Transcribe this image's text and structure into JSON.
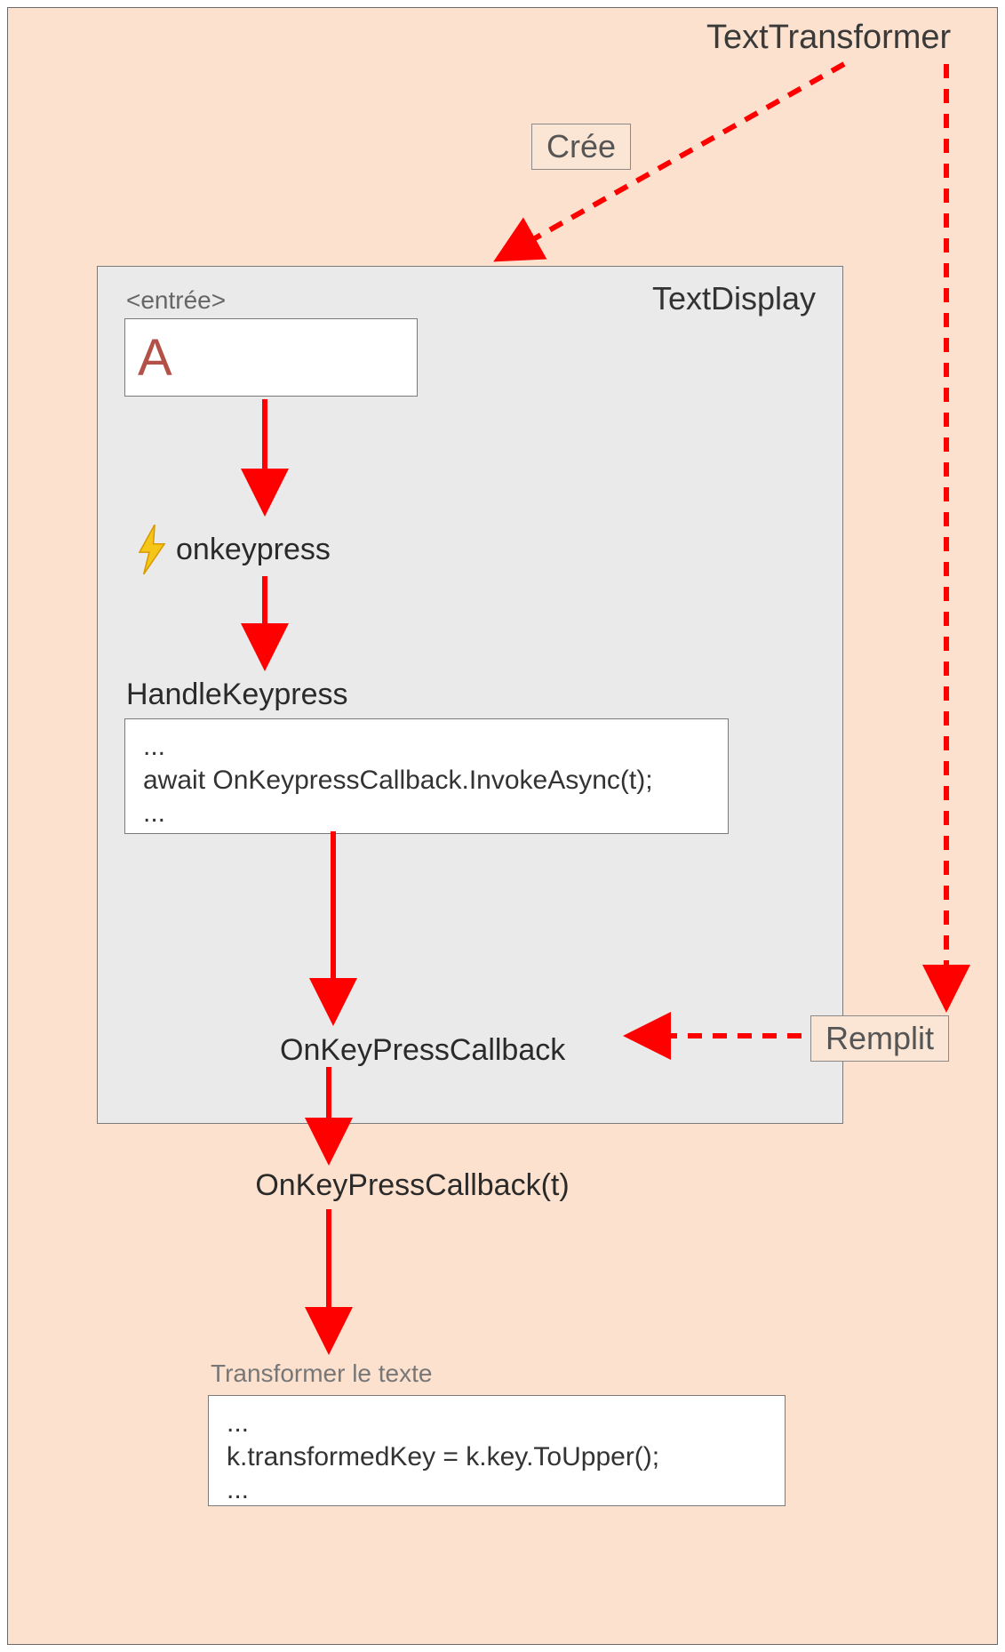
{
  "title": "TextTransformer",
  "labels": {
    "cree": "Crée",
    "remplit": "Remplit"
  },
  "textDisplay": {
    "name": "TextDisplay",
    "entreeLabel": "<entrée>",
    "inputValue": "A",
    "onkeypress": "onkeypress",
    "handleKeypress": "HandleKeypress",
    "handleCode": {
      "line1": "...",
      "line2": "await OnKeypressCallback.InvokeAsync(t);",
      "line3": "..."
    },
    "onKeypressCallbackLabel": "OnKeyPressCallback"
  },
  "bottom": {
    "callLabel": "OnKeyPressCallback(t)",
    "transformerTitle": "Transformer le texte",
    "transformCode": {
      "line1": "...",
      "line2": "k.transformedKey = k.key.ToUpper();",
      "line3": "..."
    }
  }
}
